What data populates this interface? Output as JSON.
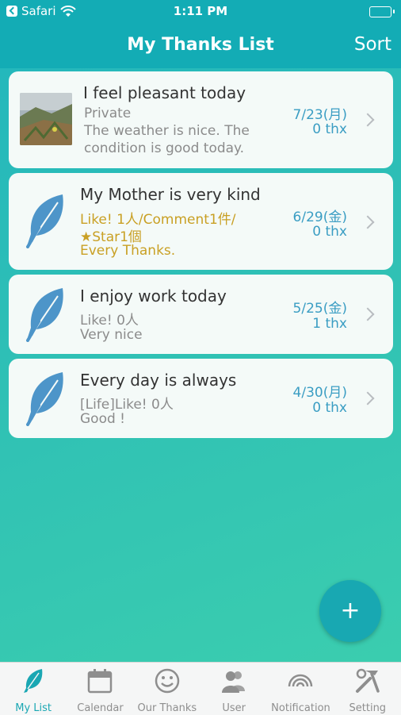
{
  "status_bar": {
    "carrier": "Safari",
    "time": "1:11 PM"
  },
  "nav": {
    "title": "My Thanks List",
    "sort_label": "Sort"
  },
  "entries": [
    {
      "title": "I feel pleasant today",
      "line1": "Private",
      "line2": "The weather is nice. The",
      "line3": "condition is good today.",
      "date": "7/23(月)",
      "thx": "0 thx",
      "icon": "photo-thumbnail"
    },
    {
      "title": "My Mother is very kind",
      "line1": "Like! 1人/Comment1件/",
      "line2": "★Star1個",
      "line3": "Every  Thanks.",
      "date": "6/29(金)",
      "thx": "0 thx",
      "icon": "feather-icon"
    },
    {
      "title": "I enjoy work today",
      "line1": "Like! 0人",
      "line2": " Very nice",
      "date": "5/25(金)",
      "thx": "1 thx",
      "icon": "feather-icon"
    },
    {
      "title": "Every day is always",
      "line1": "[Life]Like! 0人",
      "line2": " Good !",
      "date": "4/30(月)",
      "thx": "0 thx",
      "icon": "feather-icon"
    }
  ],
  "fab": {
    "label": "+"
  },
  "tabs": [
    {
      "label": "My List",
      "icon": "feather-icon",
      "active": true
    },
    {
      "label": "Calendar",
      "icon": "calendar-icon"
    },
    {
      "label": "Our Thanks",
      "icon": "smiley-icon"
    },
    {
      "label": "User",
      "icon": "users-icon"
    },
    {
      "label": "Notification",
      "icon": "signal-icon"
    },
    {
      "label": "Setting",
      "icon": "tools-icon"
    }
  ],
  "colors": {
    "accent": "#13acb5",
    "date_blue": "#3a9dc3",
    "gold": "#c9a024",
    "feather": "#4d95c9"
  }
}
